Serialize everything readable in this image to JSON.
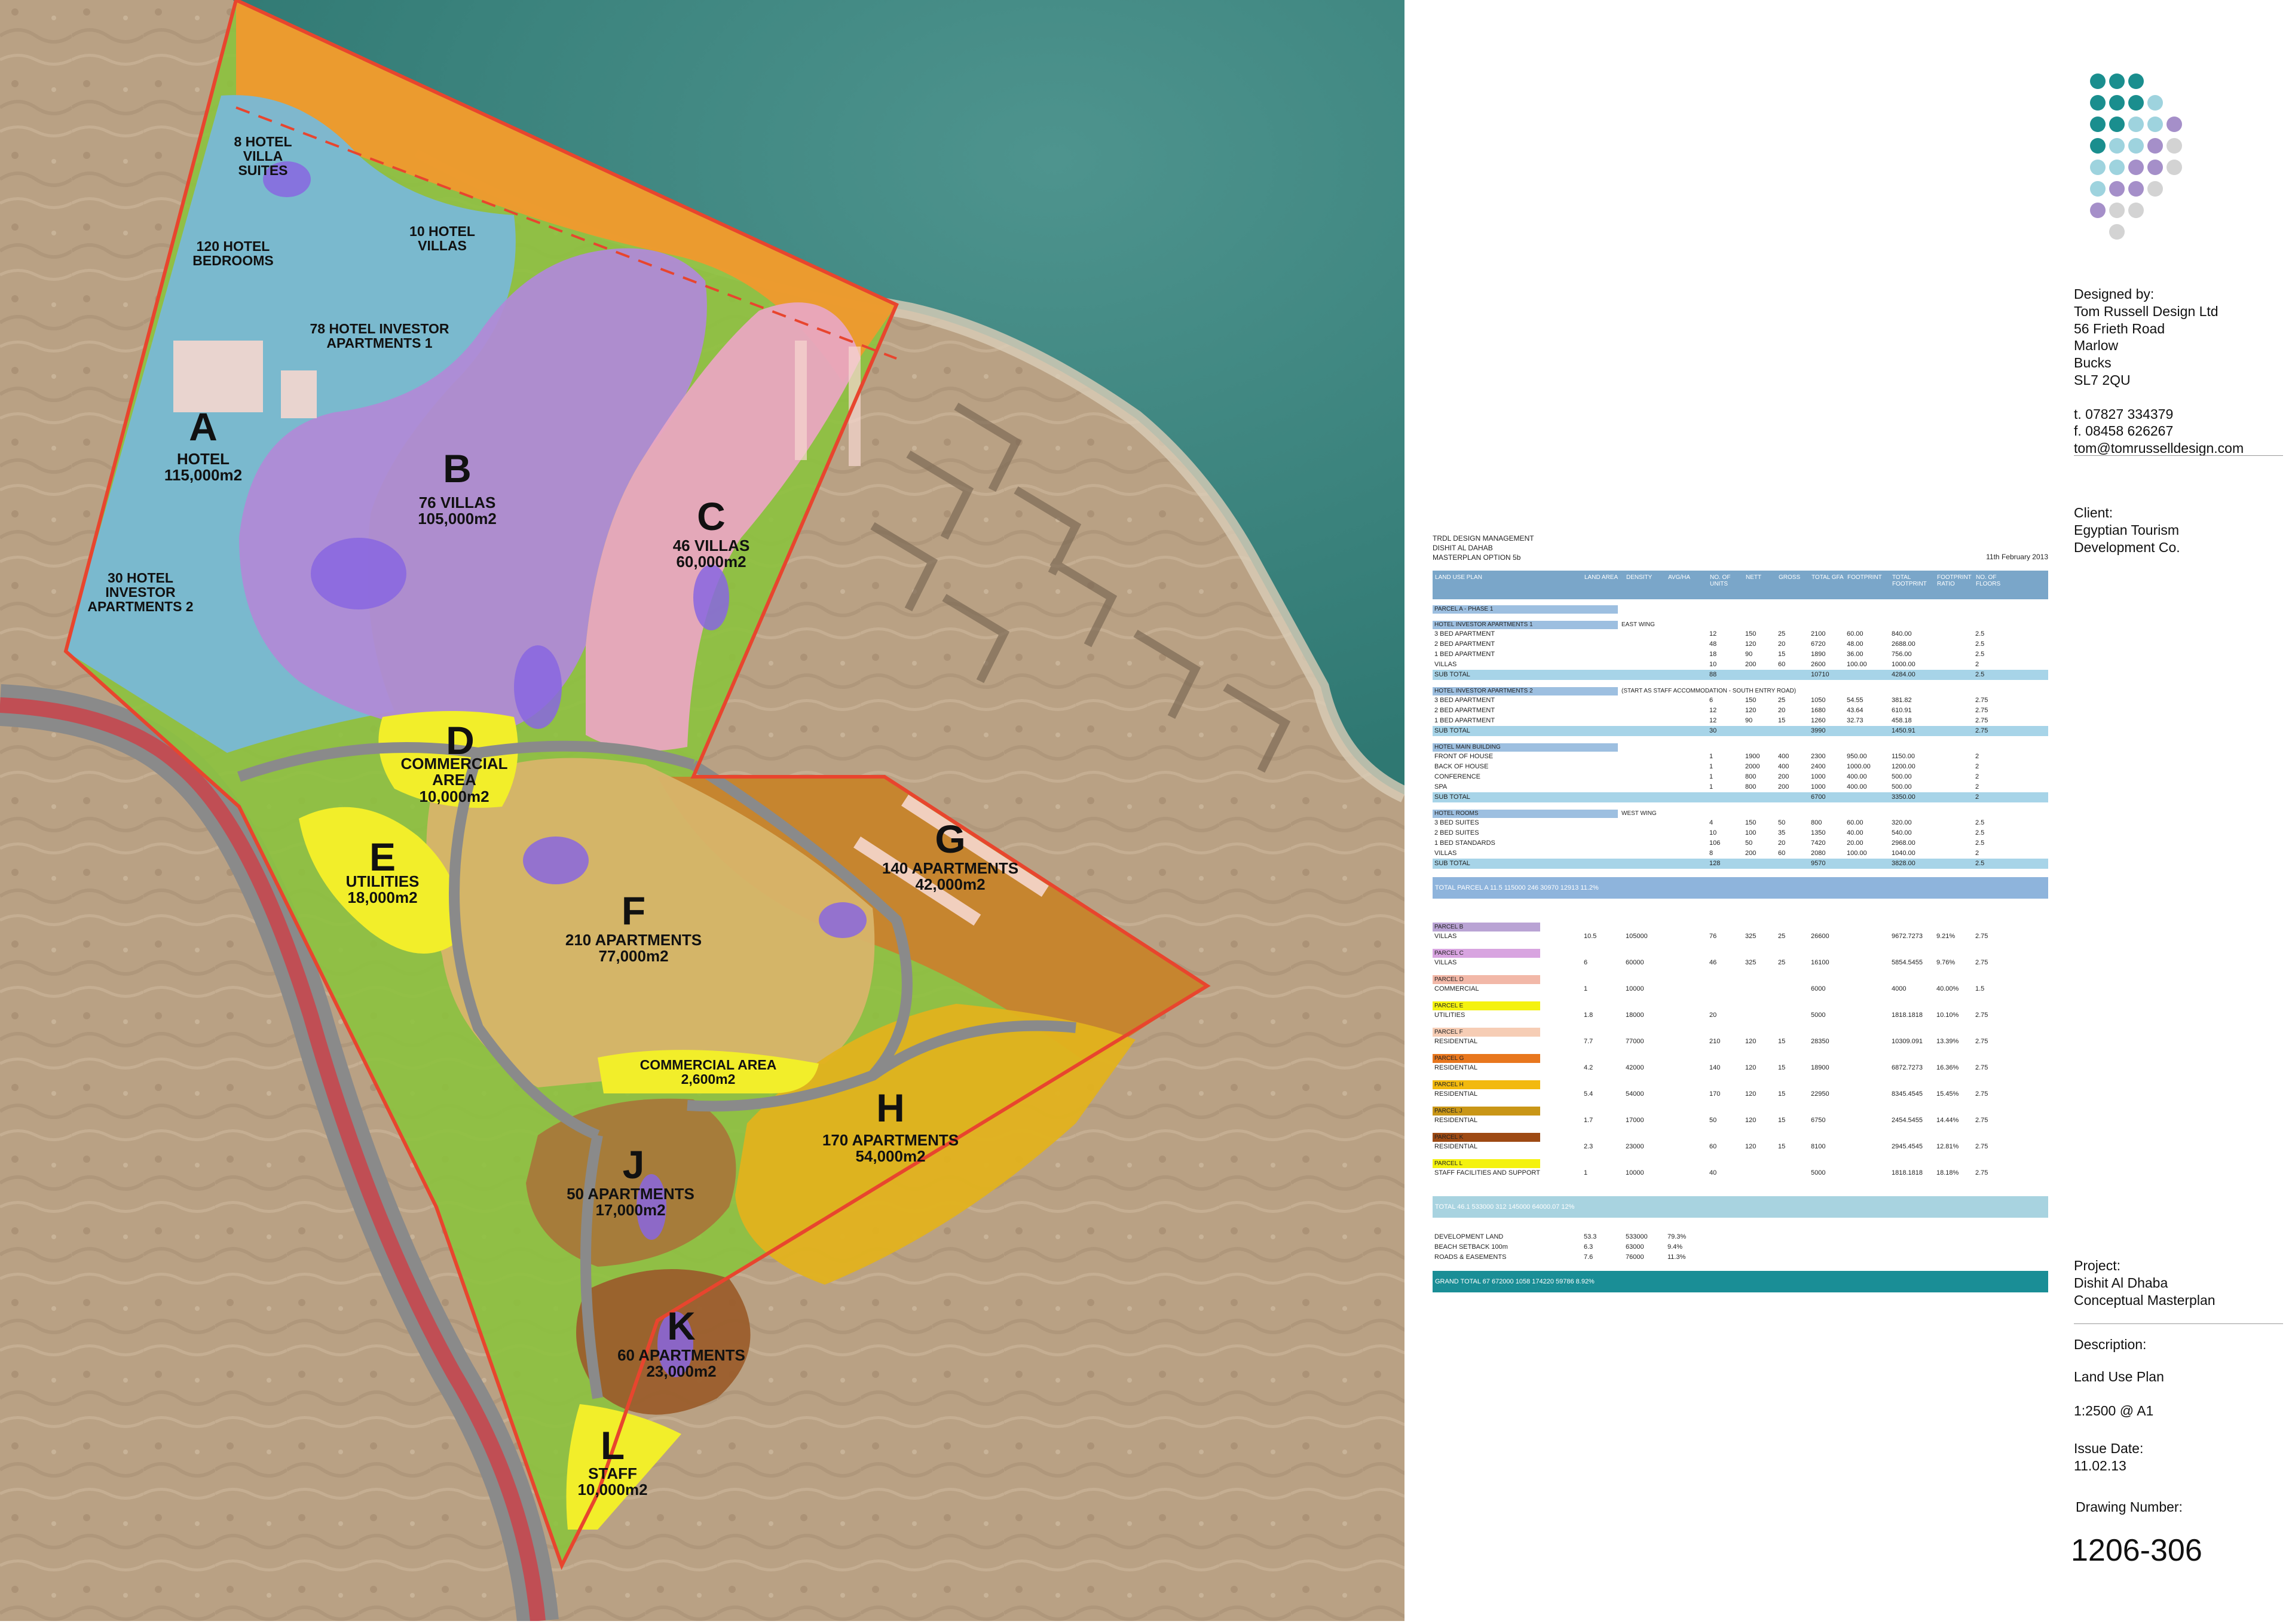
{
  "map": {
    "parcels": [
      {
        "id": "A",
        "lines": "HOTEL\n115,000m2"
      },
      {
        "id": "B",
        "lines": "76 VILLAS\n105,000m2"
      },
      {
        "id": "C",
        "lines": "46 VILLAS\n60,000m2"
      },
      {
        "id": "D",
        "lines": "COMMERCIAL\nAREA\n10,000m2"
      },
      {
        "id": "E",
        "lines": "UTILITIES\n18,000m2"
      },
      {
        "id": "F",
        "lines": "210 APARTMENTS\n77,000m2"
      },
      {
        "id": "G",
        "lines": "140 APARTMENTS\n42,000m2"
      },
      {
        "id": "H",
        "lines": "170 APARTMENTS\n54,000m2"
      },
      {
        "id": "J",
        "lines": "50 APARTMENTS\n17,000m2"
      },
      {
        "id": "K",
        "lines": "60 APARTMENTS\n23,000m2"
      },
      {
        "id": "L",
        "lines": "STAFF\n10,000m2"
      }
    ],
    "annotations": [
      "8 HOTEL\nVILLA\nSUITES",
      "120 HOTEL\nBEDROOMS",
      "10 HOTEL\nVILLAS",
      "78 HOTEL INVESTOR\nAPARTMENTS 1",
      "30 HOTEL\nINVESTOR\nAPARTMENTS 2",
      "COMMERCIAL AREA\n2,600m2"
    ],
    "colors": {
      "sea": "#3f8a86",
      "desert": "#b9a184",
      "boundary": "#e8452e",
      "orange": "#f0992e",
      "blue": "#79b8d6",
      "purple": "#b08ad6",
      "pink": "#e9a7c0",
      "yellow": "#f2ee2a",
      "olive": "#c9b63a",
      "brown": "#b5733a",
      "green": "#8cc23e",
      "road": "#8a8a8a"
    }
  },
  "logo": {
    "colors": [
      "#1a8e8e",
      "#9ed3de",
      "#a58fc9",
      "#d3d3d3"
    ]
  },
  "designer": {
    "heading": "Designed by:",
    "lines": [
      "Tom Russell Design Ltd",
      "56 Frieth Road",
      "Marlow",
      "Bucks",
      "SL7 2QU"
    ],
    "tel": "t. 07827 334379",
    "fax": "f. 08458 626267",
    "email": "tom@tomrusselldesign.com"
  },
  "client": {
    "heading": "Client:",
    "lines": [
      "Egyptian Tourism",
      "Development Co."
    ]
  },
  "project": {
    "heading": "Project:",
    "lines": [
      "Dishit Al Dhaba",
      "Conceptual Masterplan"
    ]
  },
  "description": {
    "heading": "Description:",
    "value": "Land Use Plan"
  },
  "scale": "1:2500 @ A1",
  "issue": {
    "heading": "Issue Date:",
    "value": "11.02.13"
  },
  "drawing": {
    "heading": "Drawing Number:",
    "value": "1206-306"
  },
  "sheet": {
    "meta": [
      "TRDL DESIGN MANAGEMENT",
      "DISHIT AL DAHAB",
      "MASTERPLAN OPTION 5b"
    ],
    "date": "11th February 2013",
    "headers": [
      "LAND USE PLAN",
      "LAND AREA",
      "DENSITY",
      "AVG/HA",
      "NO. OF UNITS",
      "NETT",
      "GROSS",
      "TOTAL GFA",
      "FOOTPRINT",
      "TOTAL FOOTPRINT",
      "FOOTPRINT RATIO",
      "NO. OF FLOORS"
    ],
    "parcel_a_title": "PARCEL A - PHASE 1",
    "groups": [
      {
        "title": "HOTEL INVESTOR APARTMENTS 1",
        "note": "EAST WING",
        "rows": [
          [
            "3 BED APARTMENT",
            "",
            "",
            "",
            "12",
            "150",
            "25",
            "2100",
            "60.00",
            "840.00",
            "",
            "2.5"
          ],
          [
            "2 BED APARTMENT",
            "",
            "",
            "",
            "48",
            "120",
            "20",
            "6720",
            "48.00",
            "2688.00",
            "",
            "2.5"
          ],
          [
            "1 BED APARTMENT",
            "",
            "",
            "",
            "18",
            "90",
            "15",
            "1890",
            "36.00",
            "756.00",
            "",
            "2.5"
          ],
          [
            "VILLAS",
            "",
            "",
            "",
            "10",
            "200",
            "60",
            "2600",
            "100.00",
            "1000.00",
            "",
            "2"
          ],
          [
            "SUB TOTAL",
            "",
            "",
            "",
            "88",
            "",
            "",
            "10710",
            "",
            "4284.00",
            "",
            "2.5"
          ]
        ]
      },
      {
        "title": "HOTEL INVESTOR APARTMENTS 2",
        "note": "(START AS STAFF ACCOMMODATION - SOUTH ENTRY ROAD)",
        "rows": [
          [
            "3 BED APARTMENT",
            "",
            "",
            "",
            "6",
            "150",
            "25",
            "1050",
            "54.55",
            "381.82",
            "",
            "2.75"
          ],
          [
            "2 BED APARTMENT",
            "",
            "",
            "",
            "12",
            "120",
            "20",
            "1680",
            "43.64",
            "610.91",
            "",
            "2.75"
          ],
          [
            "1 BED APARTMENT",
            "",
            "",
            "",
            "12",
            "90",
            "15",
            "1260",
            "32.73",
            "458.18",
            "",
            "2.75"
          ],
          [
            "SUB TOTAL",
            "",
            "",
            "",
            "30",
            "",
            "",
            "3990",
            "",
            "1450.91",
            "",
            "2.75"
          ]
        ]
      },
      {
        "title": "HOTEL MAIN BUILDING",
        "note": "",
        "rows": [
          [
            "FRONT OF HOUSE",
            "",
            "",
            "",
            "1",
            "1900",
            "400",
            "2300",
            "950.00",
            "1150.00",
            "",
            "2"
          ],
          [
            "BACK OF HOUSE",
            "",
            "",
            "",
            "1",
            "2000",
            "400",
            "2400",
            "1000.00",
            "1200.00",
            "",
            "2"
          ],
          [
            "CONFERENCE",
            "",
            "",
            "",
            "1",
            "800",
            "200",
            "1000",
            "400.00",
            "500.00",
            "",
            "2"
          ],
          [
            "SPA",
            "",
            "",
            "",
            "1",
            "800",
            "200",
            "1000",
            "400.00",
            "500.00",
            "",
            "2"
          ],
          [
            "SUB TOTAL",
            "",
            "",
            "",
            "",
            "",
            "",
            "6700",
            "",
            "3350.00",
            "",
            "2"
          ]
        ]
      },
      {
        "title": "HOTEL ROOMS",
        "note": "WEST WING",
        "rows": [
          [
            "3 BED SUITES",
            "",
            "",
            "",
            "4",
            "150",
            "50",
            "800",
            "60.00",
            "320.00",
            "",
            "2.5"
          ],
          [
            "2 BED SUITES",
            "",
            "",
            "",
            "10",
            "100",
            "35",
            "1350",
            "40.00",
            "540.00",
            "",
            "2.5"
          ],
          [
            "1 BED STANDARDS",
            "",
            "",
            "",
            "106",
            "50",
            "20",
            "7420",
            "20.00",
            "2968.00",
            "",
            "2.5"
          ],
          [
            "VILLAS",
            "",
            "",
            "",
            "8",
            "200",
            "60",
            "2080",
            "100.00",
            "1040.00",
            "",
            "2"
          ],
          [
            "SUB TOTAL",
            "",
            "",
            "",
            "128",
            "",
            "",
            "9570",
            "",
            "3828.00",
            "",
            "2.5"
          ]
        ]
      }
    ],
    "total_a": [
      "TOTAL PARCEL A",
      "11.5",
      "115000",
      "",
      "246",
      "",
      "",
      "",
      "30970",
      "",
      "12913",
      "11.2%",
      ""
    ],
    "parcels": [
      {
        "tag": "PARCEL B",
        "color": "#b9a3d4",
        "row": [
          "VILLAS",
          "10.5",
          "105000",
          "",
          "76",
          "325",
          "25",
          "26600",
          "",
          "9672.7273",
          "9.21%",
          "2.75"
        ]
      },
      {
        "tag": "PARCEL C",
        "color": "#d8a4e0",
        "row": [
          "VILLAS",
          "6",
          "60000",
          "",
          "46",
          "325",
          "25",
          "16100",
          "",
          "5854.5455",
          "9.76%",
          "2.75"
        ]
      },
      {
        "tag": "PARCEL D",
        "color": "#f2b8a8",
        "row": [
          "COMMERCIAL",
          "1",
          "10000",
          "",
          "",
          "",
          "",
          "6000",
          "",
          "4000",
          "40.00%",
          "1.5"
        ]
      },
      {
        "tag": "PARCEL E",
        "color": "#f4f20f",
        "row": [
          "UTILITIES",
          "1.8",
          "18000",
          "",
          "20",
          "",
          "",
          "5000",
          "",
          "1818.1818",
          "10.10%",
          "2.75"
        ]
      },
      {
        "tag": "PARCEL F",
        "color": "#f6cdb5",
        "row": [
          "RESIDENTIAL",
          "7.7",
          "77000",
          "",
          "210",
          "120",
          "15",
          "28350",
          "",
          "10309.091",
          "13.39%",
          "2.75"
        ]
      },
      {
        "tag": "PARCEL G",
        "color": "#e8771e",
        "row": [
          "RESIDENTIAL",
          "4.2",
          "42000",
          "",
          "140",
          "120",
          "15",
          "18900",
          "",
          "6872.7273",
          "16.36%",
          "2.75"
        ]
      },
      {
        "tag": "PARCEL H",
        "color": "#f2b90f",
        "row": [
          "RESIDENTIAL",
          "5.4",
          "54000",
          "",
          "170",
          "120",
          "15",
          "22950",
          "",
          "8345.4545",
          "15.45%",
          "2.75"
        ]
      },
      {
        "tag": "PARCEL J",
        "color": "#c99617",
        "row": [
          "RESIDENTIAL",
          "1.7",
          "17000",
          "",
          "50",
          "120",
          "15",
          "6750",
          "",
          "2454.5455",
          "14.44%",
          "2.75"
        ]
      },
      {
        "tag": "PARCEL K",
        "color": "#9e4a14",
        "row": [
          "RESIDENTIAL",
          "2.3",
          "23000",
          "",
          "60",
          "120",
          "15",
          "8100",
          "",
          "2945.4545",
          "12.81%",
          "2.75"
        ]
      },
      {
        "tag": "PARCEL L",
        "color": "#f4f20f",
        "row": [
          "STAFF FACILITIES AND SUPPORT",
          "1",
          "10000",
          "",
          "40",
          "",
          "",
          "5000",
          "",
          "1818.1818",
          "18.18%",
          "2.75"
        ]
      }
    ],
    "grand_band": [
      "TOTAL",
      "46.1",
      "533000",
      "",
      "312",
      "",
      "",
      "145000",
      "",
      "64000.07",
      "12%",
      ""
    ],
    "land_rows": [
      [
        "DEVELOPMENT LAND",
        "53.3",
        "533000",
        "79.3%"
      ],
      [
        "BEACH SETBACK     100m",
        "6.3",
        "63000",
        "9.4%"
      ],
      [
        "ROADS & EASEMENTS",
        "7.6",
        "76000",
        "11.3%"
      ]
    ],
    "grand_total": [
      "GRAND TOTAL",
      "67",
      "672000",
      "",
      "1058",
      "",
      "",
      "174220",
      "",
      "59786",
      "8.92%",
      ""
    ]
  }
}
